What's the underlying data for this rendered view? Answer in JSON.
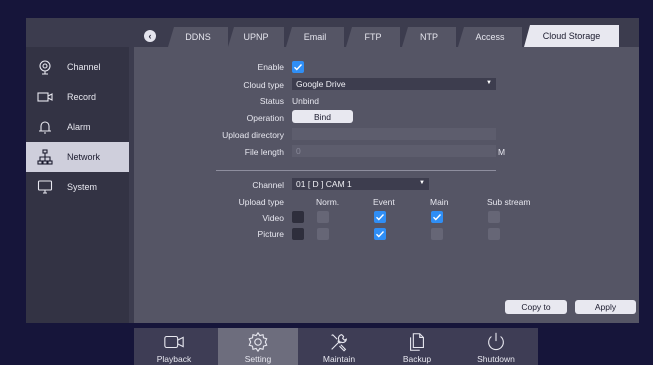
{
  "sidebar": {
    "items": [
      {
        "label": "Channel",
        "icon": "webcam-icon"
      },
      {
        "label": "Record",
        "icon": "camcorder-icon"
      },
      {
        "label": "Alarm",
        "icon": "bell-icon"
      },
      {
        "label": "Network",
        "icon": "network-icon",
        "active": true
      },
      {
        "label": "System",
        "icon": "monitor-icon"
      }
    ]
  },
  "tabs": {
    "back": "‹",
    "items": [
      "DDNS",
      "UPNP",
      "Email",
      "FTP",
      "NTP",
      "Access",
      "Cloud Storage"
    ],
    "active": "Cloud Storage"
  },
  "form": {
    "enable_label": "Enable",
    "enable_checked": true,
    "cloud_type_label": "Cloud type",
    "cloud_type_value": "Google Drive",
    "status_label": "Status",
    "status_value": "Unbind",
    "operation_label": "Operation",
    "bind_button": "Bind",
    "upload_dir_label": "Upload directory",
    "upload_dir_value": "",
    "file_length_label": "File length",
    "file_length_value": "0",
    "file_length_unit": "M",
    "channel_label": "Channel",
    "channel_value": "01 [ D ] CAM 1",
    "upload_type_label": "Upload type",
    "col_norm": "Norm.",
    "col_event": "Event",
    "col_main": "Main",
    "col_sub": "Sub stream",
    "video_label": "Video",
    "picture_label": "Picture"
  },
  "actions": {
    "copy_to": "Copy to",
    "apply": "Apply"
  },
  "dock": {
    "items": [
      "Playback",
      "Setting",
      "Maintain",
      "Backup",
      "Shutdown"
    ],
    "active": "Setting"
  },
  "colors": {
    "accent": "#2f8ef5",
    "background": "#16153a",
    "panel": "#555565"
  }
}
